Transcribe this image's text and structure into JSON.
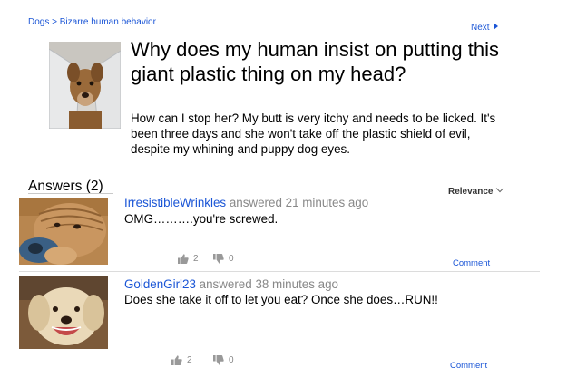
{
  "breadcrumb": {
    "category": "Dogs",
    "separator": ">",
    "subcategory": "Bizarre human behavior"
  },
  "nav": {
    "next_label": "Next"
  },
  "question": {
    "title": "Why does my human insist on putting this giant plastic thing on my head?",
    "body": "How can I stop her? My butt is very itchy and needs to be licked. It's been three days and she won't take off the plastic shield of evil, despite my whining and puppy dog eyes."
  },
  "answers_section": {
    "heading": "Answers (2)",
    "sort_label": "Relevance"
  },
  "answers": [
    {
      "username": "IrresistibleWrinkles",
      "answered_label": "answered",
      "time": "21 minutes ago",
      "text": "OMG……….you're screwed.",
      "upvotes": "2",
      "downvotes": "0",
      "comment_label": "Comment"
    },
    {
      "username": "GoldenGirl23",
      "answered_label": "answered",
      "time": "38 minutes ago",
      "text": "Does she take it off to let you eat? Once she does…RUN!!",
      "upvotes": "2",
      "downvotes": "0",
      "comment_label": "Comment"
    }
  ],
  "colors": {
    "link": "#1a55d6",
    "muted": "#888888"
  },
  "icons": [
    "thumbs-up-icon",
    "thumbs-down-icon",
    "chevron-down-icon",
    "triangle-right-icon"
  ]
}
